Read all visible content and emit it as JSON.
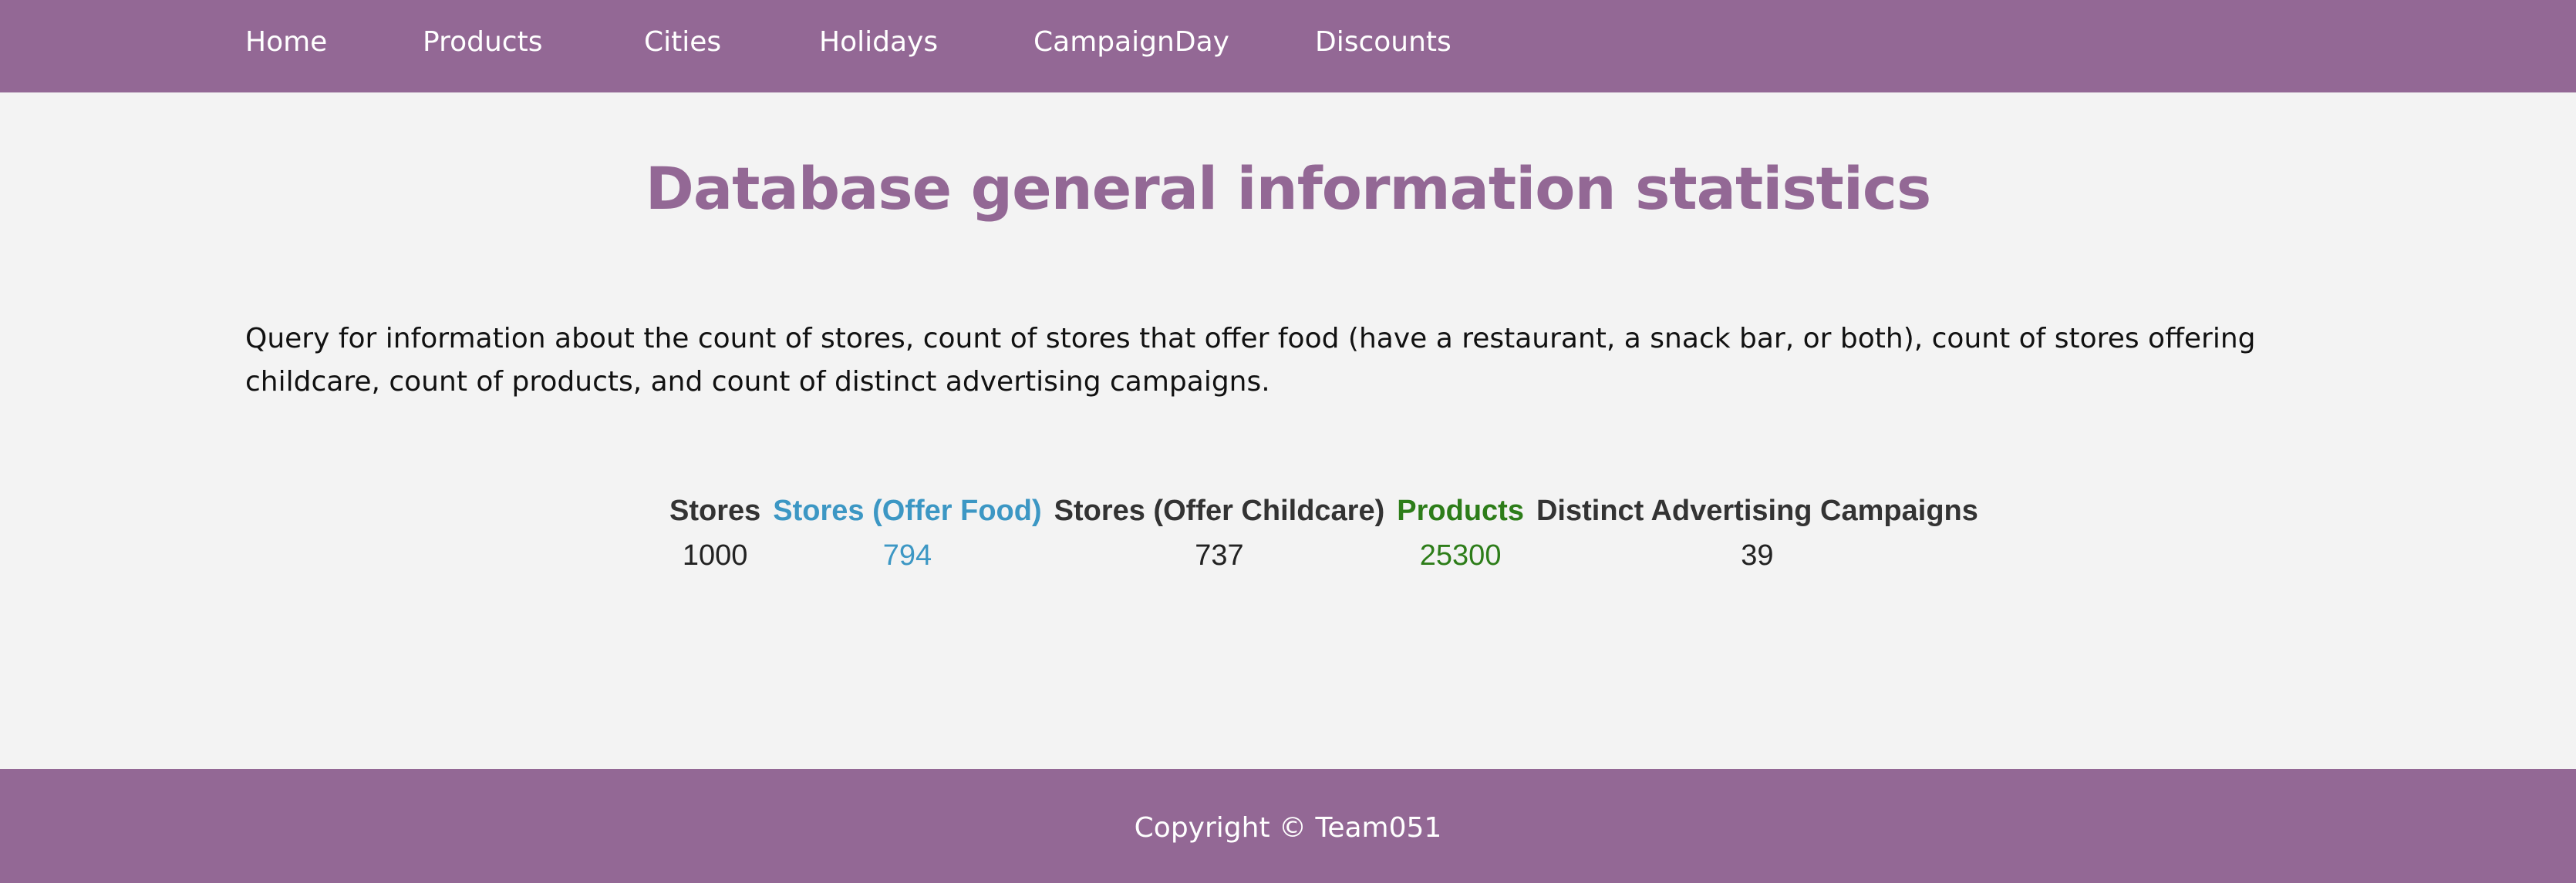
{
  "nav": {
    "items": [
      {
        "label": "Home"
      },
      {
        "label": "Products"
      },
      {
        "label": "Cities"
      },
      {
        "label": "Holidays"
      },
      {
        "label": "CampaignDay"
      },
      {
        "label": "Discounts"
      }
    ]
  },
  "main": {
    "title": "Database general information statistics",
    "description": "Query for information about the count of stores, count of stores that offer food (have a restaurant, a snack bar, or both), count of stores offering childcare, count of products, and count of distinct advertising campaigns.",
    "table": {
      "headers": [
        "Stores",
        "Stores (Offer Food)",
        "Stores (Offer Childcare)",
        "Products",
        "Distinct Advertising Campaigns"
      ],
      "values": [
        "1000",
        "794",
        "737",
        "25300",
        "39"
      ]
    }
  },
  "footer": {
    "text": "Copyright © Team051"
  },
  "colors": {
    "brand": "#936895",
    "background": "#f3f3f3",
    "food_accent": "#3c97c4",
    "products_accent": "#2d7d19"
  }
}
